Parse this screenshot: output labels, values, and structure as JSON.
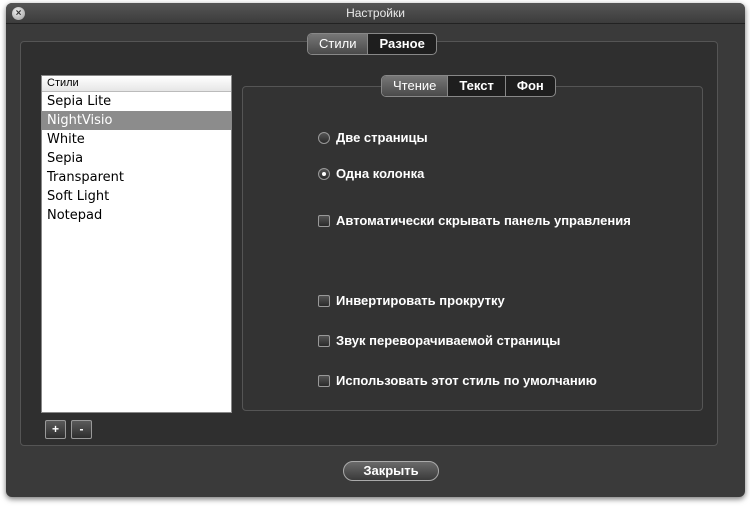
{
  "window": {
    "title": "Настройки",
    "close_icon": "close-icon"
  },
  "top_tabs": [
    {
      "label": "Стили",
      "active": true
    },
    {
      "label": "Разное",
      "active": false
    }
  ],
  "styles_list": {
    "header": "Стили",
    "items": [
      "Sepia Lite",
      "NightVisio",
      "White",
      "Sepia",
      "Transparent",
      "Soft Light",
      "Notepad"
    ],
    "selected_index": 1
  },
  "list_buttons": {
    "add": "+",
    "remove": "-"
  },
  "inner_tabs": [
    {
      "label": "Чтение",
      "active": true
    },
    {
      "label": "Текст",
      "active": false
    },
    {
      "label": "Фон",
      "active": false
    }
  ],
  "options": {
    "two_pages": {
      "label": "Две страницы",
      "checked": false
    },
    "one_column": {
      "label": "Одна колонка",
      "checked": true
    },
    "auto_hide": {
      "label": "Автоматически скрывать панель управления",
      "checked": false
    },
    "invert_scroll": {
      "label": "Инвертировать прокрутку",
      "checked": false
    },
    "page_sound": {
      "label": "Звук переворачиваемой страницы",
      "checked": false
    },
    "default_style": {
      "label": "Использовать этот стиль по умолчанию",
      "checked": false
    }
  },
  "footer": {
    "close_label": "Закрыть"
  }
}
